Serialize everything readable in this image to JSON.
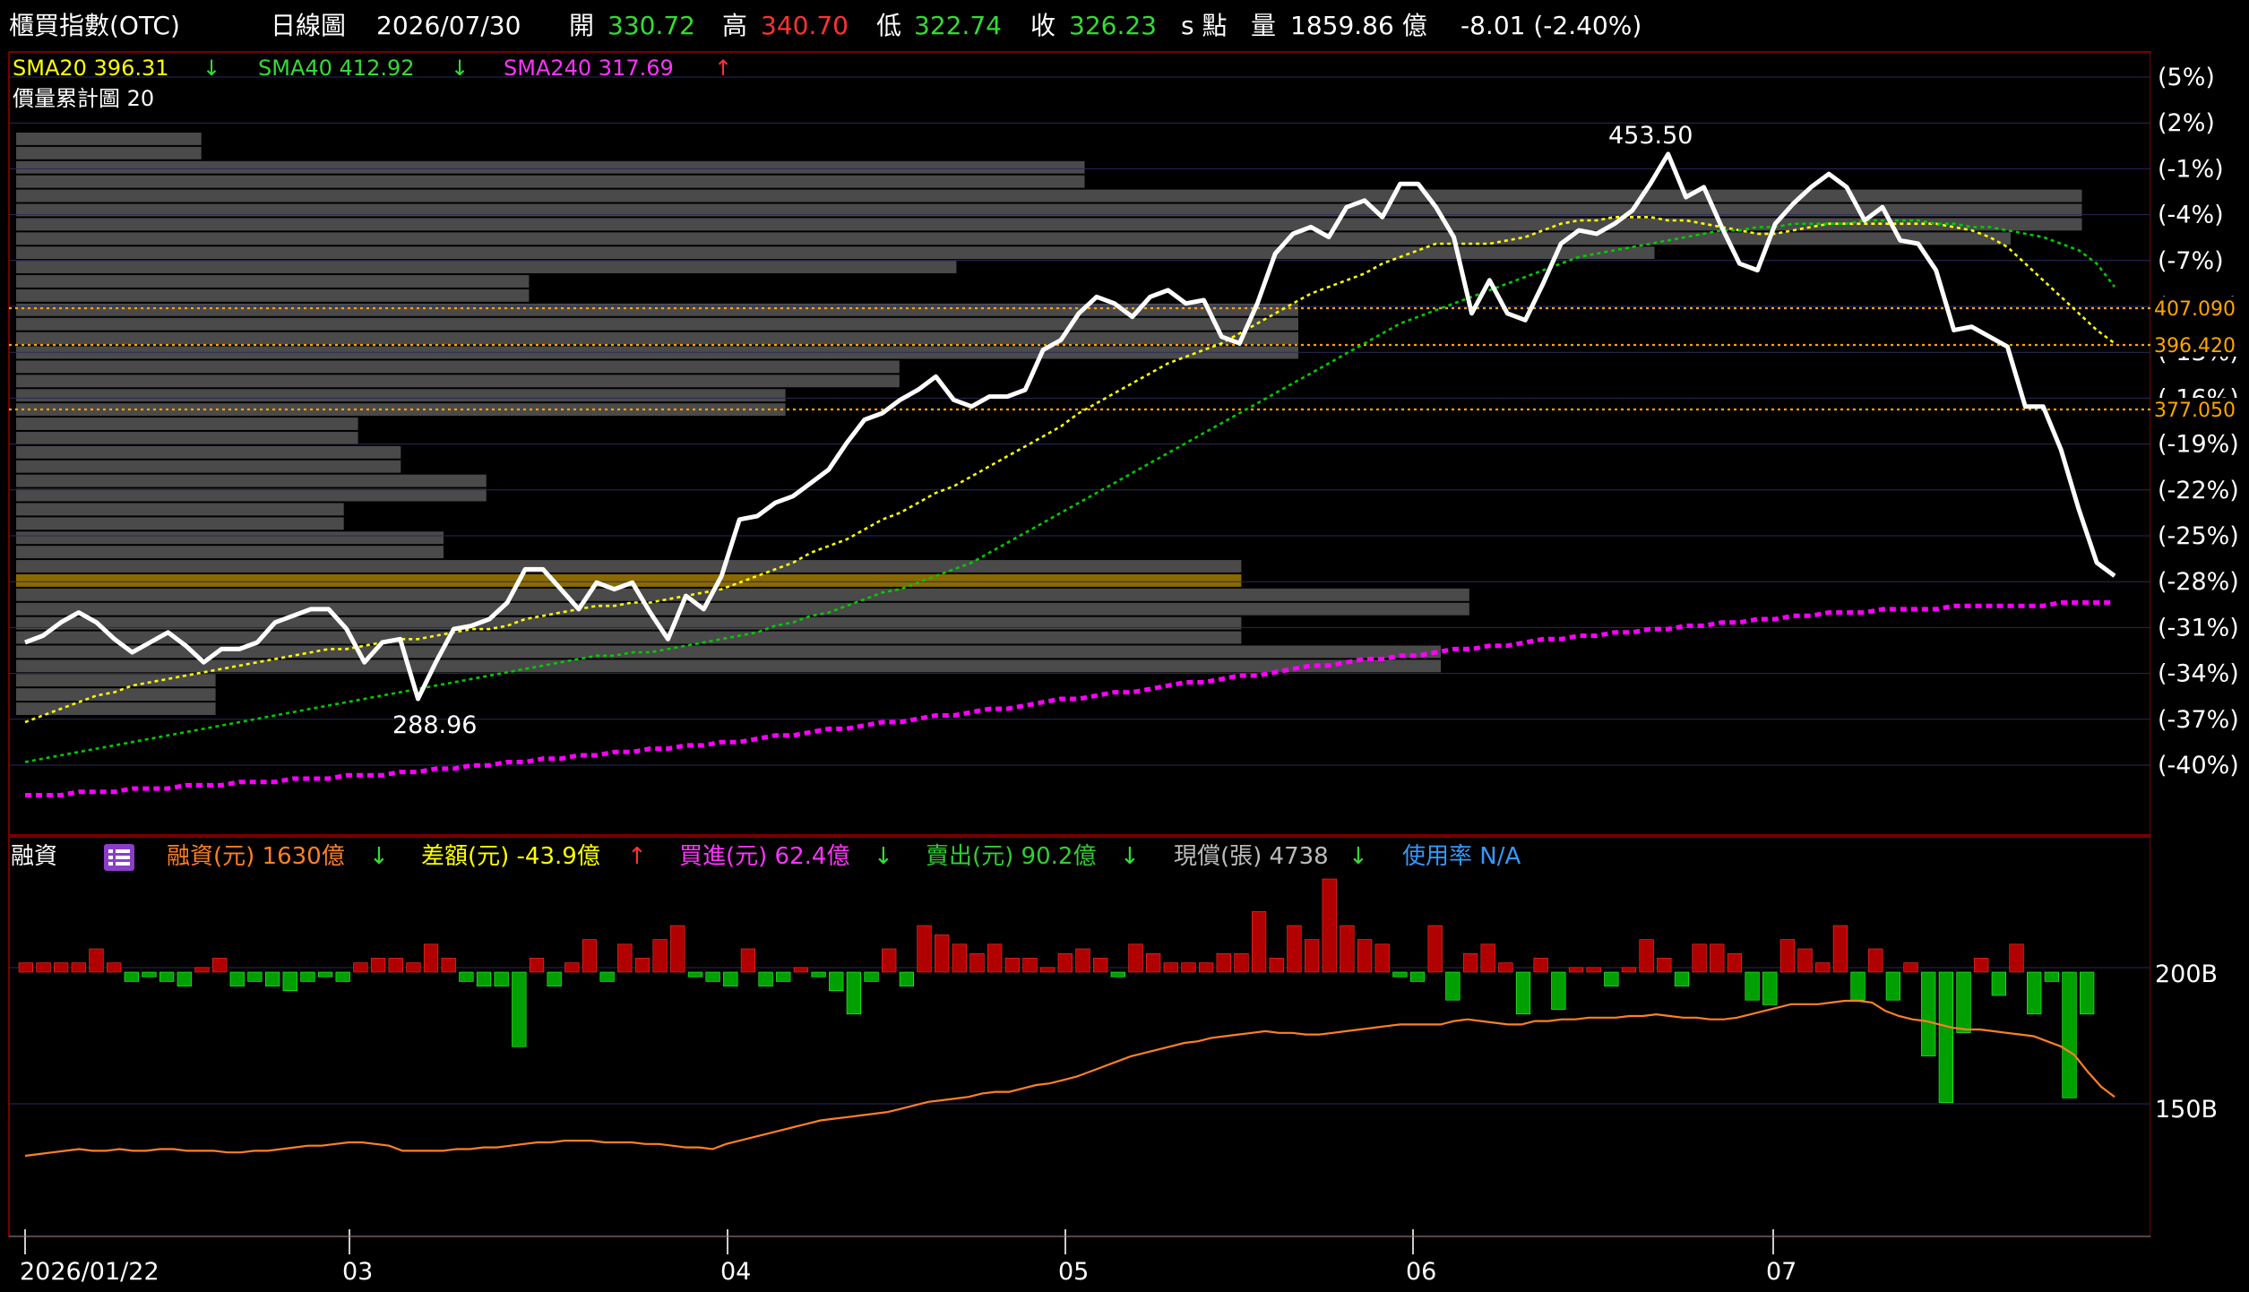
{
  "header": {
    "instrument": "櫃買指數(OTC)",
    "period": "日線圖",
    "date": "2026/07/30",
    "open_label": "開",
    "open": "330.72",
    "high_label": "高",
    "high": "340.70",
    "low_label": "低",
    "low": "322.74",
    "close_label": "收",
    "close": "326.23",
    "unit": "s 點",
    "volume_label": "量",
    "volume": "1859.86 億",
    "change": "-8.01 (-2.40%)"
  },
  "ma_legend": {
    "sma20": {
      "label": "SMA20 396.31",
      "arrow": "↓",
      "color": "#ffff00"
    },
    "sma40": {
      "label": "SMA40 412.92",
      "arrow": "↓",
      "color": "#00dd00"
    },
    "sma240": {
      "label": "SMA240 317.69",
      "arrow": "↑",
      "color": "#ff33ff"
    },
    "volume_profile": "價量累計圖 20"
  },
  "colors": {
    "price": "#ffffff",
    "sma20": "#ffff00",
    "sma40": "#00cc00",
    "sma240": "#ff00ff",
    "profile_bar": "#4a4a4a",
    "profile_highlight": "#8a6a00",
    "level_line": "#ffa500",
    "up_bar": "#b00000",
    "down_bar": "#00a000",
    "margin_line": "#ff7f27",
    "grid": "#2a2a5a",
    "axis": "#a0a0a0"
  },
  "sub_legend": {
    "title": "融資",
    "icon": "list-icon",
    "margin": {
      "label": "融資(元) 1630億",
      "arrow": "↓",
      "color": "#ff7f27"
    },
    "diff": {
      "label": "差額(元) -43.9億",
      "arrow": "↑",
      "color": "#ffff00"
    },
    "buy": {
      "label": "買進(元) 62.4億",
      "arrow": "↓",
      "color": "#ff33ff"
    },
    "sell": {
      "label": "賣出(元) 90.2億",
      "arrow": "↓",
      "color": "#33cc33"
    },
    "repay": {
      "label": "現償(張) 4738",
      "arrow": "↓",
      "color": "#bbbbbb"
    },
    "usage": {
      "label": "使用率 N/A",
      "color": "#3399ff"
    }
  },
  "chart_data": [
    {
      "type": "line",
      "title": "櫃買指數(OTC) 日線圖",
      "y_axis_right_ticks": [
        "(5%)",
        "(2%)",
        "(-1%)",
        "(-4%)",
        "(-7%)",
        "(-10%)",
        "(-13%)",
        "(-16%)",
        "(-19%)",
        "(-22%)",
        "(-25%)",
        "(-28%)",
        "(-31%)",
        "(-34%)",
        "(-37%)",
        "(-40%)"
      ],
      "ylim": [
        260,
        480
      ],
      "price_levels": [
        407.09,
        396.42,
        377.05
      ],
      "price_level_labels": [
        "407.090",
        "396.420",
        "377.050"
      ],
      "annotations": [
        {
          "label": "453.50",
          "value": 453.5
        },
        {
          "label": "288.96",
          "value": 288.96
        }
      ],
      "series": [
        {
          "name": "價",
          "values": [
            306,
            308,
            312,
            315,
            312,
            307,
            303,
            306,
            309,
            305,
            300,
            304,
            304,
            306,
            312,
            314,
            316,
            316,
            310,
            300,
            306,
            307,
            289,
            300,
            310,
            311,
            313,
            318,
            328,
            328,
            322,
            316,
            324,
            322,
            324,
            315,
            307,
            320,
            316,
            326,
            343,
            344,
            348,
            350,
            354,
            358,
            366,
            373,
            375,
            379,
            382,
            386,
            379,
            377,
            380,
            380,
            382,
            394,
            397,
            405,
            410,
            408,
            404,
            410,
            412,
            408,
            409,
            398,
            396,
            408,
            423,
            429,
            431,
            428,
            437,
            439,
            434,
            444,
            444,
            437,
            428,
            405,
            415,
            405,
            403,
            414,
            426,
            430,
            429,
            432,
            436,
            444,
            453,
            440,
            443,
            431,
            420,
            418,
            432,
            438,
            443,
            447,
            443,
            433,
            437,
            427,
            426,
            418,
            400,
            401,
            398,
            395,
            377,
            377,
            364,
            346,
            330,
            326
          ]
        },
        {
          "name": "SMA20",
          "values": [
            282,
            284,
            286,
            288,
            290,
            291,
            293,
            294,
            295,
            296,
            297,
            298,
            299,
            300,
            301,
            302,
            303,
            304,
            304,
            305,
            306,
            307,
            307,
            308,
            309,
            310,
            310,
            311,
            313,
            314,
            315,
            316,
            317,
            317,
            318,
            318,
            319,
            320,
            321,
            322,
            324,
            326,
            328,
            330,
            333,
            335,
            337,
            340,
            343,
            345,
            348,
            351,
            353,
            356,
            359,
            362,
            365,
            368,
            371,
            375,
            378,
            381,
            384,
            387,
            390,
            392,
            394,
            396,
            399,
            402,
            405,
            408,
            411,
            413,
            415,
            417,
            420,
            422,
            424,
            426,
            426,
            426,
            426,
            427,
            428,
            430,
            432,
            433,
            433,
            434,
            434,
            434,
            433,
            433,
            432,
            431,
            430,
            429,
            429,
            430,
            431,
            432,
            432,
            432,
            432,
            432,
            432,
            432,
            431,
            430,
            428,
            425,
            420,
            415,
            410,
            405,
            400,
            396
          ]
        },
        {
          "name": "SMA40",
          "values": [
            270,
            271,
            272,
            273,
            274,
            275,
            276,
            277,
            278,
            279,
            280,
            281,
            282,
            283,
            284,
            285,
            286,
            287,
            288,
            289,
            290,
            291,
            292,
            293,
            294,
            295,
            296,
            297,
            298,
            299,
            300,
            301,
            302,
            302,
            303,
            303,
            304,
            305,
            306,
            307,
            308,
            309,
            311,
            312,
            314,
            315,
            317,
            319,
            321,
            322,
            324,
            326,
            328,
            330,
            333,
            336,
            339,
            342,
            345,
            348,
            351,
            354,
            357,
            360,
            363,
            366,
            369,
            372,
            375,
            378,
            381,
            384,
            387,
            390,
            393,
            396,
            399,
            402,
            404,
            406,
            408,
            410,
            412,
            414,
            416,
            418,
            420,
            422,
            423,
            424,
            425,
            426,
            427,
            428,
            429,
            430,
            430,
            431,
            431,
            432,
            432,
            432,
            432,
            433,
            433,
            433,
            433,
            432,
            432,
            431,
            431,
            430,
            429,
            428,
            426,
            424,
            420,
            413
          ]
        },
        {
          "name": "SMA240",
          "values": [
            260,
            260,
            260,
            261,
            261,
            261,
            262,
            262,
            262,
            263,
            263,
            263,
            264,
            264,
            264,
            265,
            265,
            265,
            266,
            266,
            266,
            267,
            267,
            268,
            268,
            269,
            269,
            270,
            270,
            271,
            271,
            272,
            272,
            273,
            273,
            274,
            274,
            275,
            275,
            276,
            276,
            277,
            278,
            278,
            279,
            280,
            280,
            281,
            282,
            282,
            283,
            284,
            284,
            285,
            286,
            286,
            287,
            288,
            289,
            289,
            290,
            291,
            291,
            292,
            293,
            294,
            294,
            295,
            296,
            296,
            297,
            298,
            299,
            299,
            300,
            301,
            301,
            302,
            302,
            303,
            304,
            304,
            305,
            305,
            306,
            307,
            307,
            308,
            308,
            309,
            309,
            310,
            310,
            311,
            311,
            312,
            312,
            313,
            313,
            314,
            314,
            315,
            315,
            315,
            316,
            316,
            316,
            316,
            317,
            317,
            317,
            317,
            317,
            317,
            318,
            318,
            318,
            318
          ]
        }
      ]
    },
    {
      "type": "bar",
      "title": "價量累計圖 20",
      "price_bins": [
        451,
        447,
        443,
        439,
        435,
        431,
        427,
        423,
        419,
        415,
        411,
        407,
        403,
        399,
        395,
        391,
        387,
        383,
        379,
        375,
        371,
        367,
        363,
        359,
        355,
        351,
        347,
        343,
        339,
        335,
        331,
        327,
        323,
        319,
        315,
        311,
        307,
        303,
        299,
        295,
        291
      ],
      "values": [
        13,
        13,
        75,
        75,
        145,
        145,
        145,
        140,
        115,
        66,
        36,
        36,
        90,
        90,
        90,
        90,
        62,
        62,
        54,
        54,
        24,
        24,
        27,
        27,
        33,
        33,
        23,
        23,
        30,
        30,
        86,
        86,
        102,
        102,
        86,
        86,
        100,
        100,
        14,
        14,
        14
      ],
      "highlight_bin": 327
    },
    {
      "type": "bar",
      "title": "融資",
      "series": [
        {
          "name": "差額(元)",
          "values": [
            2,
            2,
            2,
            2,
            5,
            2,
            -2,
            -1,
            -2,
            -3,
            1,
            3,
            -3,
            -2,
            -3,
            -4,
            -2,
            -1,
            -2,
            2,
            3,
            3,
            2,
            6,
            3,
            -2,
            -3,
            -3,
            -16,
            3,
            -3,
            2,
            7,
            -2,
            6,
            3,
            7,
            10,
            -1,
            -2,
            -3,
            5,
            -3,
            -2,
            1,
            -1,
            -4,
            -9,
            -2,
            5,
            -3,
            10,
            8,
            6,
            4,
            6,
            3,
            3,
            1,
            4,
            5,
            3,
            -1,
            6,
            4,
            2,
            2,
            2,
            4,
            4,
            13,
            3,
            10,
            7,
            20,
            10,
            7,
            6,
            -1,
            -2,
            10,
            -6,
            4,
            6,
            2,
            -9,
            3,
            -8,
            1,
            1,
            -3,
            1,
            7,
            3,
            -3,
            6,
            6,
            4,
            -6,
            -7,
            7,
            5,
            2,
            10,
            -6,
            5,
            -6,
            2,
            -18,
            -28,
            -13,
            3,
            -5,
            6,
            -9,
            -2,
            -27,
            -9
          ]
        },
        {
          "name": "融資(元)",
          "values": [
            130,
            131,
            132,
            133,
            134,
            133,
            133,
            134,
            133,
            133,
            134,
            134,
            133,
            133,
            133,
            132,
            132,
            133,
            133,
            134,
            135,
            136,
            136,
            137,
            138,
            138,
            137,
            136,
            133,
            133,
            133,
            133,
            134,
            134,
            135,
            135,
            136,
            137,
            138,
            138,
            139,
            139,
            139,
            138,
            138,
            138,
            137,
            137,
            136,
            135,
            135,
            134,
            137,
            139,
            141,
            143,
            145,
            147,
            149,
            151,
            152,
            153,
            154,
            155,
            156,
            158,
            160,
            162,
            163,
            164,
            165,
            167,
            168,
            168,
            170,
            172,
            173,
            175,
            177,
            180,
            183,
            186,
            189,
            191,
            193,
            195,
            197,
            198,
            200,
            201,
            202,
            203,
            204,
            203,
            203,
            202,
            202,
            203,
            204,
            205,
            206,
            207,
            208,
            208,
            208,
            208,
            210,
            211,
            210,
            209,
            208,
            208,
            210,
            210,
            211,
            211,
            212,
            212,
            212,
            213,
            213,
            214,
            213,
            212,
            212,
            211,
            211,
            212,
            214,
            216,
            218,
            220,
            220,
            220,
            221,
            222,
            222,
            221,
            216,
            213,
            211,
            210,
            208,
            206,
            205,
            205,
            204,
            203,
            202,
            201,
            198,
            195,
            190,
            180,
            171,
            165
          ]
        }
      ],
      "y_axis_right_ticks": [
        "200B",
        "150B"
      ],
      "x_axis_ticks": [
        "2026/01/22",
        "03",
        "04",
        "05",
        "06",
        "07"
      ]
    }
  ]
}
